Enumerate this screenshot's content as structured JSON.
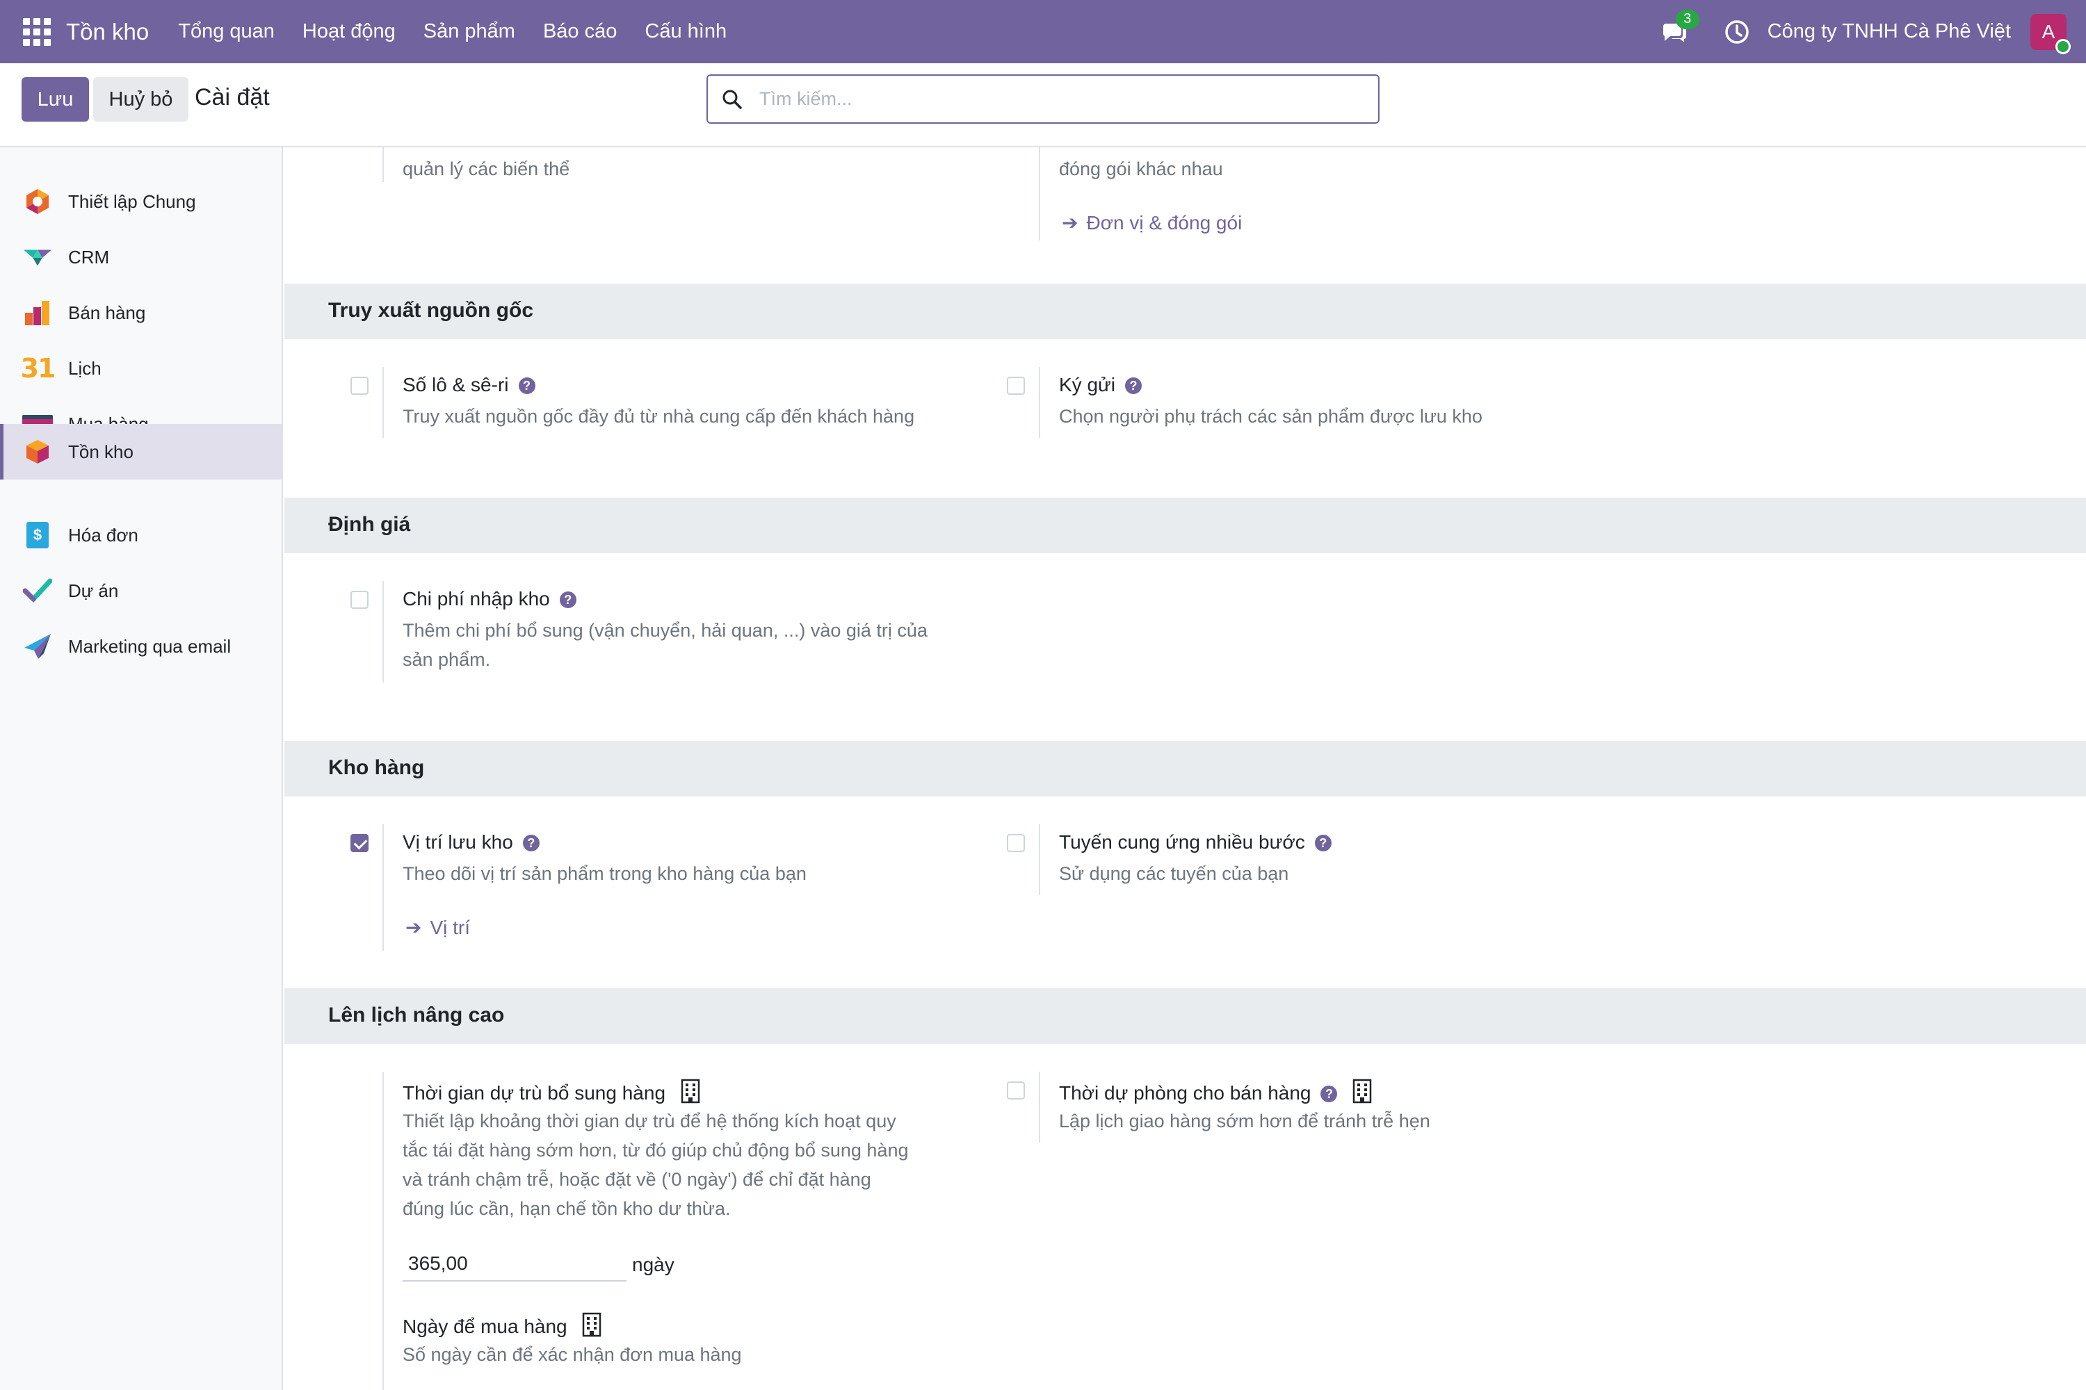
{
  "navbar": {
    "app_name": "Tồn kho",
    "menus": [
      "Tổng quan",
      "Hoạt động",
      "Sản phẩm",
      "Báo cáo",
      "Cấu hình"
    ],
    "message_count": "3",
    "company": "Công ty TNHH Cà Phê Việt",
    "avatar_letter": "A"
  },
  "control": {
    "save_label": "Lưu",
    "cancel_label": "Huỷ bỏ",
    "title": "Cài đặt",
    "search_placeholder": "Tìm kiếm..."
  },
  "sidebar": {
    "items": [
      {
        "label": "Thiết lập Chung",
        "icon": "settings-app-icon"
      },
      {
        "label": "CRM",
        "icon": "crm-app-icon"
      },
      {
        "label": "Bán hàng",
        "icon": "sales-app-icon"
      },
      {
        "label": "Lịch",
        "icon": "calendar-app-icon",
        "icon_text": "31"
      },
      {
        "label": "Mua hàng",
        "icon": "purchase-app-icon"
      },
      {
        "label": "Tồn kho",
        "icon": "inventory-app-icon",
        "active": true
      },
      {
        "label": "Hóa đơn",
        "icon": "invoicing-app-icon",
        "icon_text": "$"
      },
      {
        "label": "Dự án",
        "icon": "project-app-icon"
      },
      {
        "label": "Marketing qua email",
        "icon": "email-marketing-app-icon"
      }
    ]
  },
  "content": {
    "top_partial": {
      "left_desc": "quản lý các biến thể",
      "right_desc": "đóng gói khác nhau",
      "right_link": "Đơn vị & đóng gói"
    },
    "sections": {
      "traceability": {
        "title": "Truy xuất nguồn gốc",
        "lots": {
          "title": "Số lô & sê-ri",
          "desc": "Truy xuất nguồn gốc đầy đủ từ nhà cung cấp đến khách hàng",
          "checked": false
        },
        "consignment": {
          "title": "Ký gửi",
          "desc": "Chọn người phụ trách các sản phẩm được lưu kho",
          "checked": false
        }
      },
      "valuation": {
        "title": "Định giá",
        "landed_costs": {
          "title": "Chi phí nhập kho",
          "desc1": "Thêm chi phí bổ sung (vận chuyển, hải quan, ...) vào giá trị của",
          "desc2": "sản phẩm.",
          "checked": false
        }
      },
      "warehouse": {
        "title": "Kho hàng",
        "locations": {
          "title": "Vị trí lưu kho",
          "desc": "Theo dõi vị trí sản phẩm trong kho hàng của bạn",
          "link": "Vị trí",
          "checked": true
        },
        "routes": {
          "title": "Tuyến cung ứng nhiều bước",
          "desc": "Sử dụng các tuyến của bạn",
          "checked": false
        }
      },
      "scheduling": {
        "title": "Lên lịch nâng cao",
        "horizon": {
          "title": "Thời gian dự trù bổ sung hàng",
          "desc": [
            "Thiết lập khoảng thời gian dự trù để hệ thống kích hoạt quy",
            "tắc tái đặt hàng sớm hơn, từ đó giúp chủ động bổ sung hàng",
            "và tránh chậm trễ, hoặc đặt về ('0 ngày') để chỉ đặt hàng",
            "đúng lúc cần, hạn chế tồn kho dư thừa."
          ],
          "value": "365,00",
          "unit": "ngày"
        },
        "security_lead": {
          "title": "Thời dự phòng cho bán hàng",
          "desc": "Lập lịch giao hàng sớm hơn để tránh trễ hẹn",
          "checked": false
        },
        "purchase_days": {
          "title": "Ngày để mua hàng",
          "desc": "Số ngày cần để xác nhận đơn mua hàng"
        }
      }
    }
  },
  "colors": {
    "brand": "#71639e",
    "active_sidebar": "#e2dfed",
    "badge": "#28a745"
  }
}
